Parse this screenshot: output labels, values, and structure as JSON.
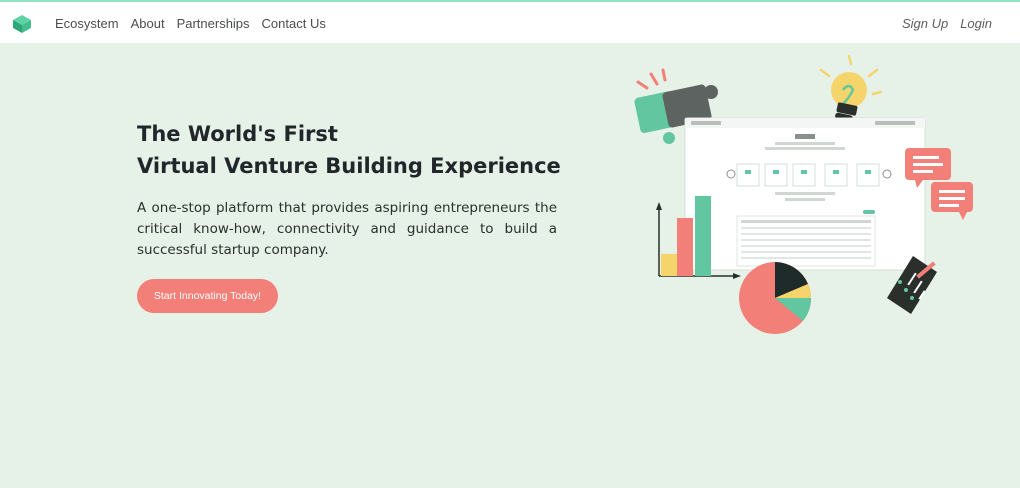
{
  "nav": {
    "items": [
      "Ecosystem",
      "About",
      "Partnerships",
      "Contact Us"
    ],
    "sign_up": "Sign Up",
    "login": "Login"
  },
  "hero": {
    "title_line1": "The World's First",
    "title_line2": "Virtual Venture Building Experience",
    "description": "A one-stop platform that provides aspiring entrepreneurs the critical know-how, connectivity and guidance to build a successful startup company.",
    "cta_label": "Start Innovating Today!"
  },
  "colors": {
    "background": "#e6f2e8",
    "accent_coral": "#f27f78",
    "accent_green": "#62c6a0",
    "accent_yellow": "#f5d56b",
    "dark": "#20262a"
  },
  "icons": {
    "logo": "layered-cube-logo",
    "illustration": [
      "puzzle-icon",
      "lightbulb-icon",
      "chat-bubble-icon",
      "bar-chart-icon",
      "pie-chart-icon",
      "document-pen-icon",
      "dashboard-screenshot"
    ]
  }
}
